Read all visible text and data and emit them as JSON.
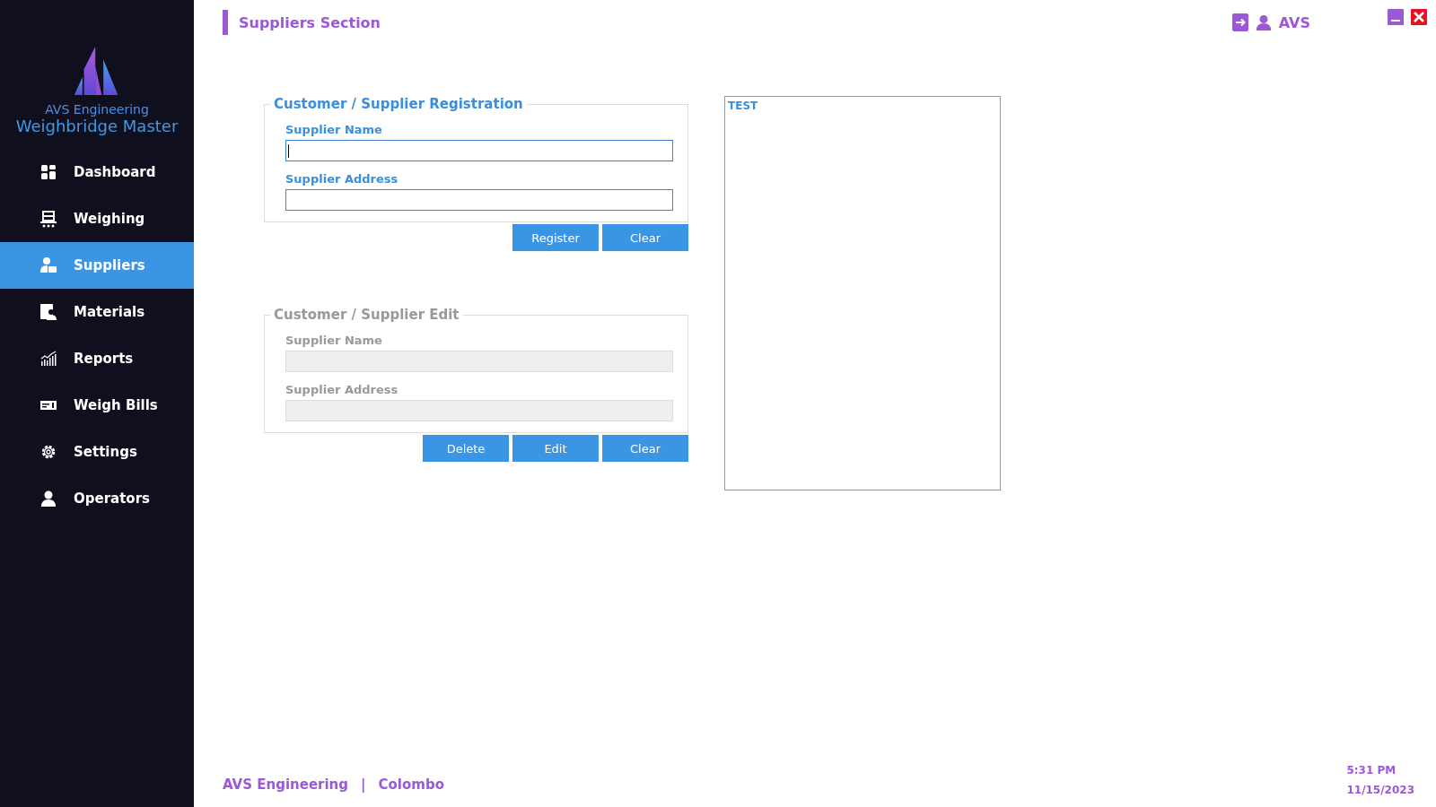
{
  "brand": {
    "company": "AVS Engineering",
    "product": "Weighbridge Master"
  },
  "nav": [
    {
      "label": "Dashboard",
      "selected": false
    },
    {
      "label": "Weighing",
      "selected": false
    },
    {
      "label": "Suppliers",
      "selected": true
    },
    {
      "label": "Materials",
      "selected": false
    },
    {
      "label": "Reports",
      "selected": false
    },
    {
      "label": "Weigh Bills",
      "selected": false
    },
    {
      "label": "Settings",
      "selected": false
    },
    {
      "label": "Operators",
      "selected": false
    }
  ],
  "header": {
    "title": "Suppliers Section",
    "user": "AVS"
  },
  "sections": [
    {
      "title": "Customer / Supplier Registration",
      "disabled": false,
      "fields": [
        {
          "label": "Supplier Name",
          "focused": true
        },
        {
          "label": "Supplier Address",
          "focused": false
        }
      ],
      "buttons": [
        "Register",
        "Clear"
      ]
    },
    {
      "title": "Customer / Supplier Edit",
      "disabled": true,
      "fields": [
        {
          "label": "Supplier Name",
          "focused": false
        },
        {
          "label": "Supplier Address",
          "focused": false
        }
      ],
      "buttons": [
        "Delete",
        "Edit",
        "Clear"
      ]
    }
  ],
  "list": {
    "items": [
      {
        "label": "TEST"
      }
    ]
  },
  "footer": {
    "company": "AVS Engineering",
    "separator": "|",
    "city": "Colombo",
    "time": "5:31 PM",
    "date": "11/15/2023"
  }
}
